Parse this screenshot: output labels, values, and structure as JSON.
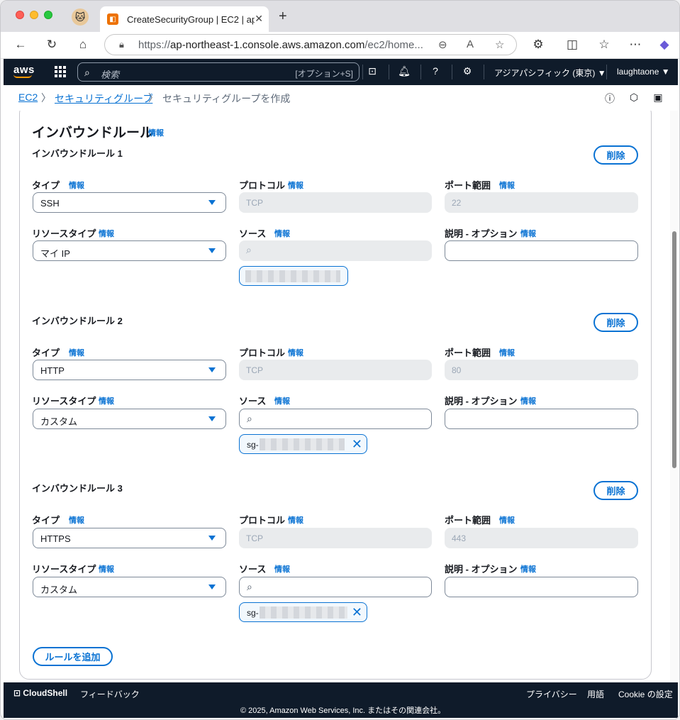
{
  "browser": {
    "tab_title": "CreateSecurityGroup | EC2 | ap-",
    "url_prefix": "https://",
    "url_host": "ap-northeast-1.console.aws.amazon.com",
    "url_path": "/ec2/home..."
  },
  "aws_nav": {
    "logo": "aws",
    "search_placeholder": "検索",
    "search_shortcut": "[オプション+S]",
    "region": "アジアパシフィック (東京) ▼",
    "user": "laughtaone ▼"
  },
  "breadcrumb": {
    "items": [
      "EC2",
      "セキュリティグループ"
    ],
    "current": "セキュリティグループを作成"
  },
  "section": {
    "title": "インバウンドルール",
    "info": "情報"
  },
  "labels": {
    "type": "タイプ",
    "protocol": "プロトコル",
    "port_range": "ポート範囲",
    "resource_type": "リソースタイプ",
    "source": "ソース",
    "description": "説明 - オプション",
    "info": "情報",
    "delete": "削除"
  },
  "rules": [
    {
      "title": "インバウンドルール 1",
      "type": "SSH",
      "protocol": "TCP",
      "port": "22",
      "resource_type": "マイ IP",
      "token_prefix": ""
    },
    {
      "title": "インバウンドルール 2",
      "type": "HTTP",
      "protocol": "TCP",
      "port": "80",
      "resource_type": "カスタム",
      "token_prefix": "sg-"
    },
    {
      "title": "インバウンドルール 3",
      "type": "HTTPS",
      "protocol": "TCP",
      "port": "443",
      "resource_type": "カスタム",
      "token_prefix": "sg-"
    }
  ],
  "add_rule": "ルールを追加",
  "footer": {
    "cloudshell": "CloudShell",
    "feedback": "フィードバック",
    "privacy": "プライバシー",
    "terms": "用語",
    "cookie": "Cookie の設定",
    "copyright": "© 2025, Amazon Web Services, Inc. またはその関連会社。"
  }
}
